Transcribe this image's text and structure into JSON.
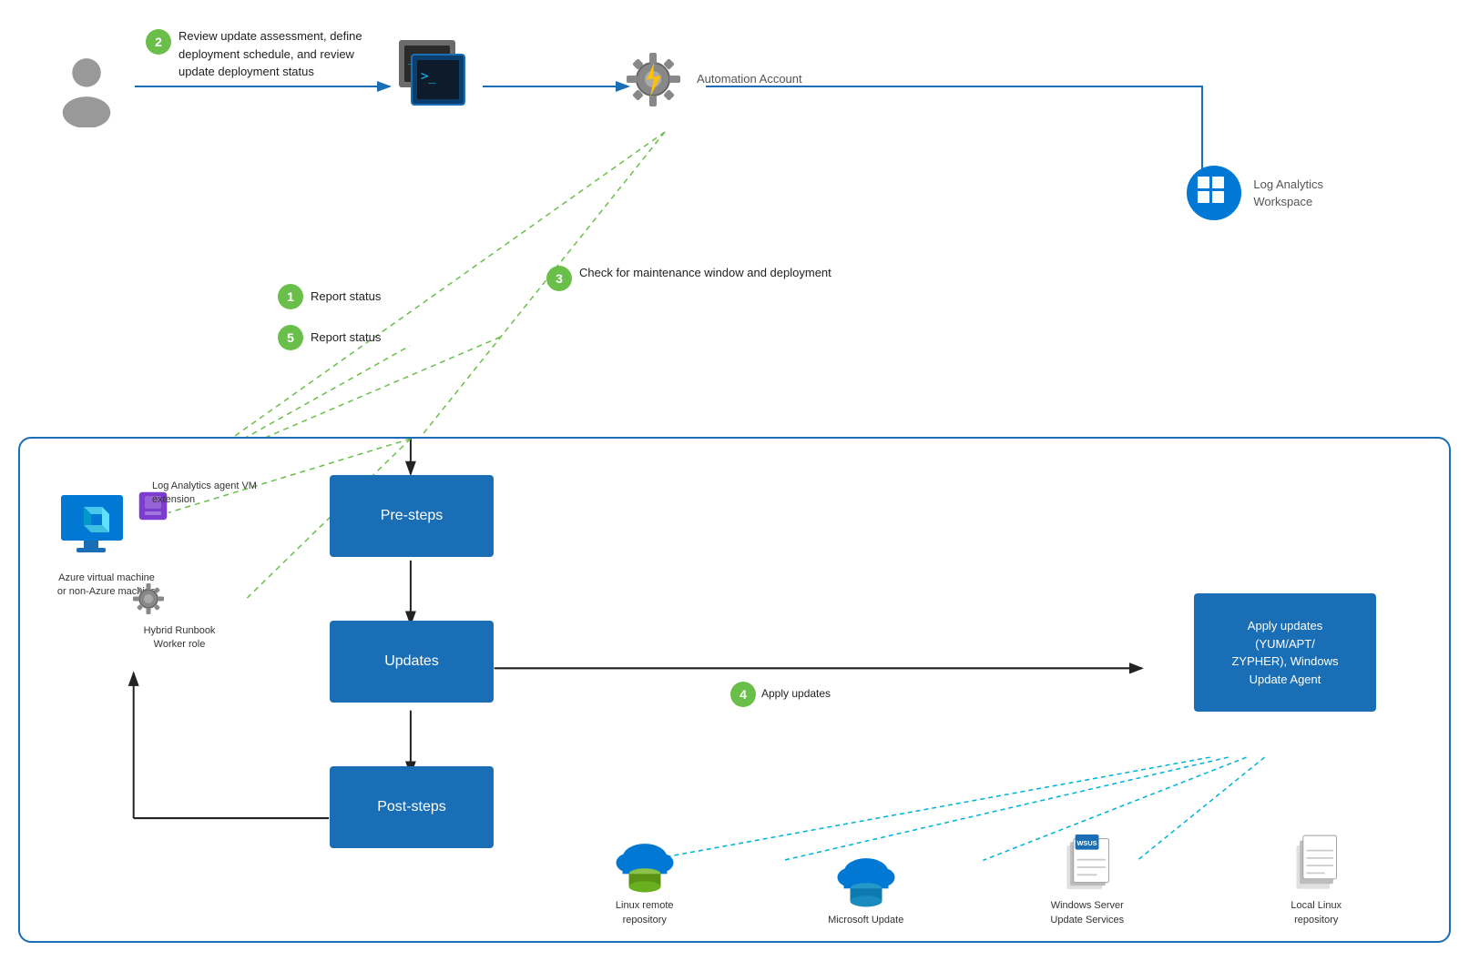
{
  "top": {
    "step2": {
      "bubble": "2",
      "text": "Review update assessment, define deployment schedule, and review update deployment status"
    },
    "step1": {
      "bubble": "1",
      "label": "Report status"
    },
    "step5": {
      "bubble": "5",
      "label": "Report status"
    },
    "step3": {
      "bubble": "3",
      "text": "Check for maintenance window and deployment"
    },
    "automation": {
      "label": "Automation\nAccount"
    },
    "law": {
      "label": "Log Analytics\nWorkspace"
    }
  },
  "bottom": {
    "vm_label": "Azure virtual\nmachine or\nnon-Azure\nmachine",
    "la_agent_label": "Log Analytics agent\nVM extension",
    "hybrid_label": "Hybrid\nRunbook\nWorker role",
    "presteps": "Pre-steps",
    "updates": "Updates",
    "poststeps": "Post-steps",
    "apply_box": "Apply updates\n(YUM/APT/\nZYPHER), Windows\nUpdate Agent",
    "step4": {
      "bubble": "4",
      "text": "Apply\nupdates"
    },
    "repos": [
      {
        "label": "Linux remote\nrepository",
        "type": "cloud-db-green"
      },
      {
        "label": "Microsoft Update",
        "type": "cloud-db-blue"
      },
      {
        "label": "Windows Server\nUpdate Services",
        "type": "wsus"
      },
      {
        "label": "Local Linux\nrepository",
        "type": "doc"
      }
    ]
  }
}
